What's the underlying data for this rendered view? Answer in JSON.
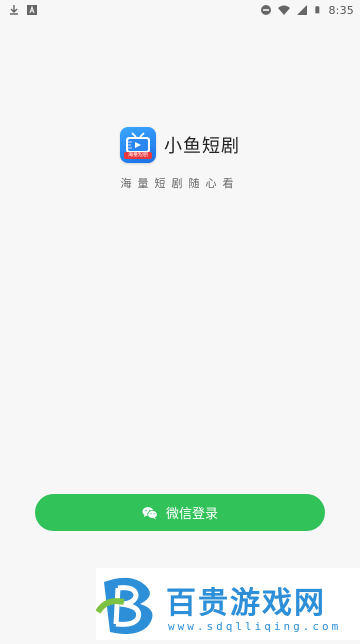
{
  "status_bar": {
    "time": "8:35",
    "left_icons": [
      "download-icon",
      "translate-icon"
    ],
    "right_icons": [
      "dnd-icon",
      "wifi-icon",
      "signal-icon",
      "battery-icon"
    ]
  },
  "app": {
    "logo_text": "海量短剧",
    "name": "小鱼短剧",
    "slogan": "海量短剧随心看"
  },
  "login": {
    "wechat_label": "微信登录",
    "icon": "wechat-icon",
    "color": "#32c25a"
  },
  "watermark": {
    "title": "百贵游戏网",
    "url": "www.sdqlliqing.com",
    "color": "#2c8fd7"
  }
}
